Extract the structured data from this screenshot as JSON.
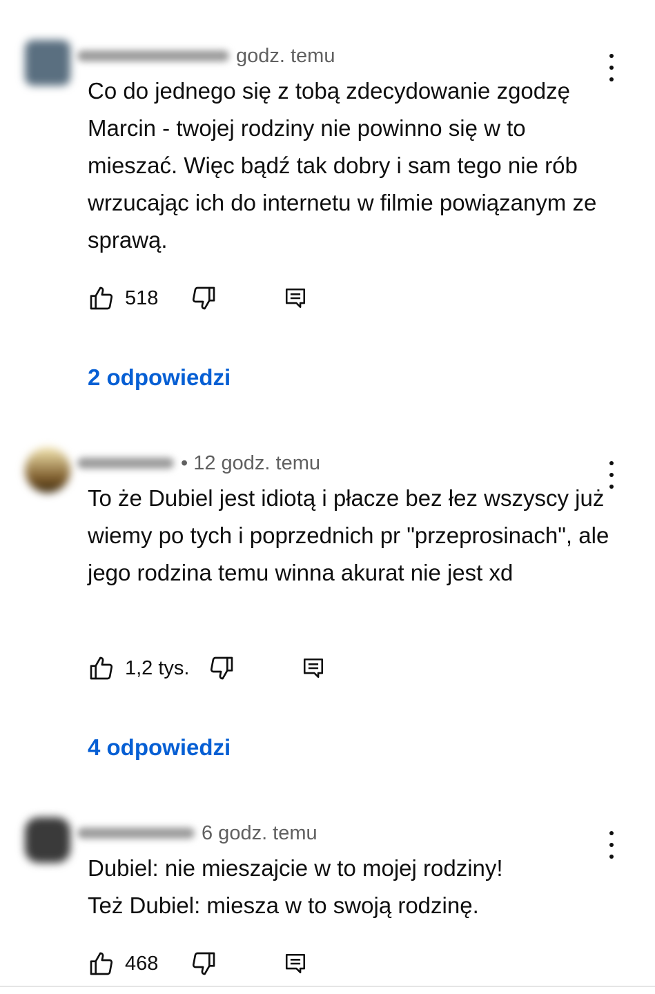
{
  "icons": {
    "like": "thumb-up-icon",
    "dislike": "thumb-down-icon",
    "reply": "reply-comment-icon",
    "more": "more-vertical-icon"
  },
  "colors": {
    "link": "#065fd4",
    "meta": "#606060",
    "text": "#0f0f0f"
  },
  "comments": [
    {
      "time": "godz. temu",
      "text": "Co do jednego się z tobą zdecydowanie zgodzę Marcin - twojej rodziny nie powinno się w to mieszać. Więc bądź tak dobry i sam tego nie rób wrzucając ich do internetu w filmie powiązanym ze sprawą.",
      "likes": "518",
      "replies": "2 odpowiedzi"
    },
    {
      "time": "• 12 godz. temu",
      "text": "To że Dubiel jest idiotą i płacze bez łez wszyscy już wiemy po tych i poprzednich pr \"przeprosinach\", ale jego rodzina temu winna akurat nie jest xd",
      "likes": "1,2 tys.",
      "replies": "4 odpowiedzi"
    },
    {
      "time": "6 godz. temu",
      "text": "Dubiel: nie mieszajcie w to mojej rodziny!\nTeż Dubiel: miesza w to swoją rodzinę.",
      "likes": "468"
    }
  ]
}
